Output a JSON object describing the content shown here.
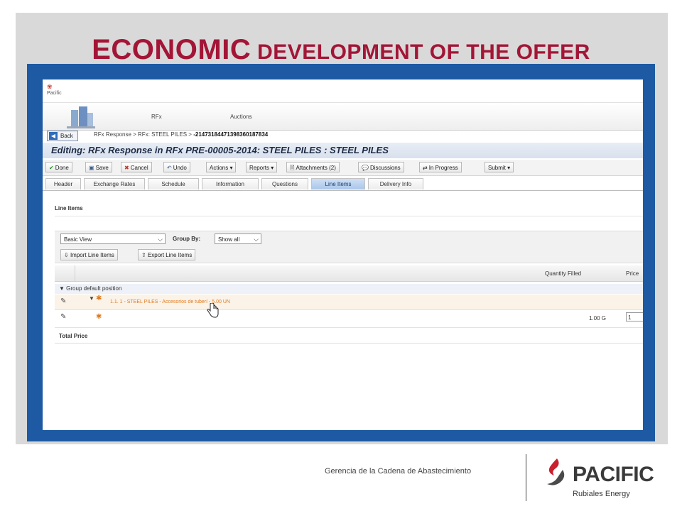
{
  "slide": {
    "title_word": "ECONOMIC",
    "title_rest": "DEVELOPMENT OF THE OFFER",
    "footer_text": "Gerencia de la Cadena de Abastecimiento",
    "logo_name": "PACIFIC",
    "logo_sub": "Rubiales Energy"
  },
  "app": {
    "logo_text": "Pacific",
    "nav_tabs": [
      "RFx",
      "Auctions"
    ],
    "back_label": "Back",
    "breadcrumb": "RFx Response  >  RFx: STEEL PILES  >",
    "breadcrumb_id": "-2147318447139836018783​4",
    "edit_title": "Editing: RFx Response in RFx PRE-00005-2014: STEEL PILES : STEEL PILES",
    "toolbar": {
      "done": "Done",
      "save": "Save",
      "cancel": "Cancel",
      "undo": "Undo",
      "actions": "Actions",
      "reports": "Reports",
      "attachments": "Attachments (2)",
      "discussions": "Discussions",
      "in_progress": "In Progress",
      "submit": "Submit"
    },
    "tabs": [
      {
        "label": "Header",
        "active": false
      },
      {
        "label": "Exchange Rates",
        "active": false
      },
      {
        "label": "Schedule",
        "active": false
      },
      {
        "label": "Information",
        "active": false
      },
      {
        "label": "Questions",
        "active": false
      },
      {
        "label": "Line Items",
        "active": true
      },
      {
        "label": "Delivery Info",
        "active": false
      }
    ],
    "section_label": "Line Items",
    "view_select": "Basic View",
    "group_by_label": "Group By:",
    "group_by_value": "Show all",
    "import_label": "Import Line Items",
    "export_label": "Export Line Items",
    "grid_headers": {
      "quantity_filled": "Quantity Filled",
      "price": "Price"
    },
    "group_label": "Group default position",
    "line_item_text": "1.1. 1 - STEEL PILES - Accesorios de tuberí - 5.00 UN",
    "qty_value": "1.00 G",
    "qty_input": "1",
    "total_label": "Total Price"
  },
  "colors": {
    "title_red": "#a31536",
    "frame_blue": "#1d5aa3",
    "line_item_orange": "#e07a1f"
  }
}
